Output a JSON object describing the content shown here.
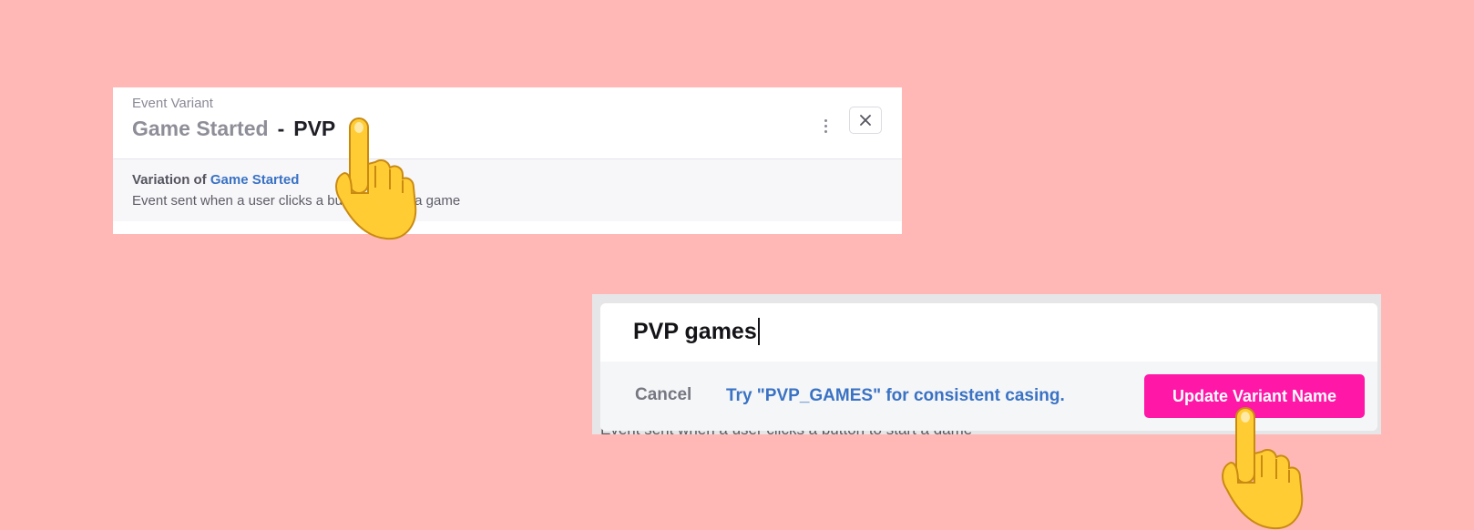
{
  "variant_panel": {
    "kicker": "Event Variant",
    "parent_event": "Game Started",
    "separator": "-",
    "variant_name": "PVP",
    "variation_prefix": "Variation of",
    "variation_link": "Game Started",
    "description": "Event sent when a user clicks a button to start a game"
  },
  "rename_dialog": {
    "background_text": "Event sent when a user clicks a button to start a game",
    "input_value": "PVP games",
    "cancel_label": "Cancel",
    "suggestion_text": "Try \"PVP_GAMES\" for consistent casing.",
    "update_label": "Update Variant Name"
  },
  "icons": {
    "more": "vertical-ellipsis-icon",
    "close": "close-icon",
    "cursor": "pointing-hand-icon"
  },
  "colors": {
    "page_background": "#ffb8b6",
    "link_blue": "#3a72c4",
    "primary_button": "#ff17a8"
  }
}
